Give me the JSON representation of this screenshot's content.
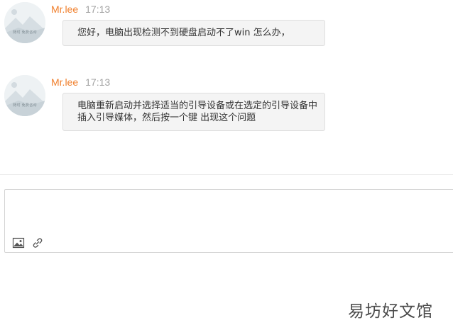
{
  "messages": [
    {
      "author": "Mr.lee",
      "time": "17:13",
      "text": "您好，电脑出现检测不到硬盘启动不了win 怎么办，",
      "avatar_caption": "随时 免费咨询"
    },
    {
      "author": "Mr.lee",
      "time": "17:13",
      "text": "电脑重新启动并选择适当的引导设备或在选定的引导设备中插入引导媒体，然后按一个键 出现这个问题",
      "avatar_caption": "随时 免费咨询"
    }
  ],
  "composer": {
    "image_tool": "image-icon",
    "link_tool": "link-icon"
  },
  "watermark": "易坊好文馆",
  "colors": {
    "author": "#f07f2c",
    "time": "#a3a3a3",
    "bubble_bg": "#f4f4f4",
    "bubble_border": "#dedede"
  }
}
